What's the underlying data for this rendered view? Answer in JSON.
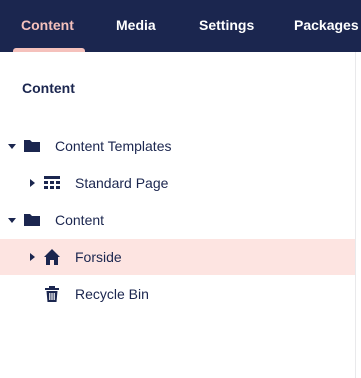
{
  "topnav": {
    "tabs": [
      {
        "label": "Content",
        "active": true
      },
      {
        "label": "Media",
        "active": false
      },
      {
        "label": "Settings",
        "active": false
      },
      {
        "label": "Packages",
        "active": false
      }
    ]
  },
  "tree": {
    "title": "Content",
    "items": [
      {
        "label": "Content Templates",
        "icon": "folder-icon",
        "expanded": true,
        "selected": false
      },
      {
        "label": "Standard Page",
        "icon": "grid-icon",
        "expanded": false,
        "selected": false
      },
      {
        "label": "Content",
        "icon": "folder-icon",
        "expanded": true,
        "selected": false
      },
      {
        "label": "Forside",
        "icon": "home-icon",
        "expanded": false,
        "selected": true
      },
      {
        "label": "Recycle Bin",
        "icon": "trash-icon",
        "expanded": false,
        "selected": false
      }
    ]
  },
  "colors": {
    "topbar": "#1b264f",
    "active_tab": "#f5c1bc",
    "selected_row": "#fde4e1",
    "text": "#1b264f"
  }
}
